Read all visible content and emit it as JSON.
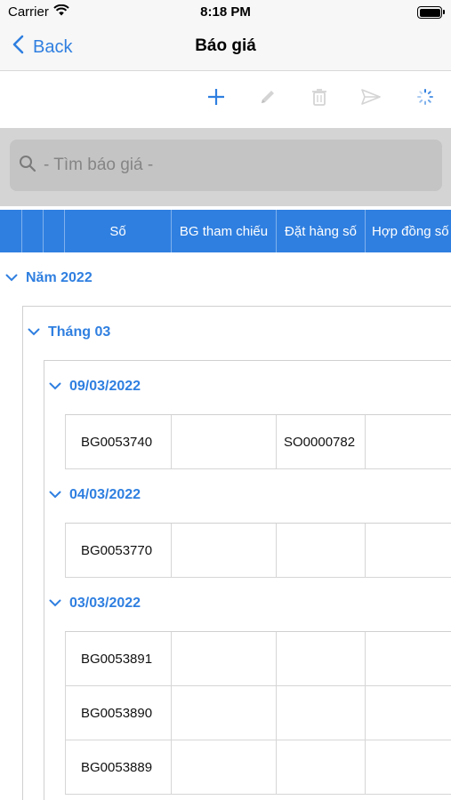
{
  "status": {
    "carrier": "Carrier",
    "time": "8:18 PM"
  },
  "nav": {
    "back_label": "Back",
    "title": "Báo giá"
  },
  "toolbar": {
    "icons": [
      "plus-icon",
      "pencil-icon",
      "trash-icon",
      "send-icon",
      "refresh-spinner-icon"
    ],
    "accent": "#2f7fe0",
    "disabled_color": "#d0d0d0"
  },
  "search": {
    "placeholder": "- Tìm báo giá -"
  },
  "grid": {
    "columns": [
      "Số",
      "BG tham chiếu",
      "Đặt hàng số",
      "Hợp đồng số"
    ],
    "header_color": "#2f7fe0",
    "year_group": "Năm 2022",
    "month_group": "Tháng 03",
    "date_groups": [
      {
        "date": "09/03/2022",
        "rows": [
          {
            "so": "BG0053740",
            "bg_ref": "",
            "order": "SO0000782",
            "contract": ""
          }
        ]
      },
      {
        "date": "04/03/2022",
        "rows": [
          {
            "so": "BG0053770",
            "bg_ref": "",
            "order": "",
            "contract": ""
          }
        ]
      },
      {
        "date": "03/03/2022",
        "rows": [
          {
            "so": "BG0053891",
            "bg_ref": "",
            "order": "",
            "contract": ""
          },
          {
            "so": "BG0053890",
            "bg_ref": "",
            "order": "",
            "contract": ""
          },
          {
            "so": "BG0053889",
            "bg_ref": "",
            "order": "",
            "contract": ""
          }
        ]
      }
    ]
  }
}
